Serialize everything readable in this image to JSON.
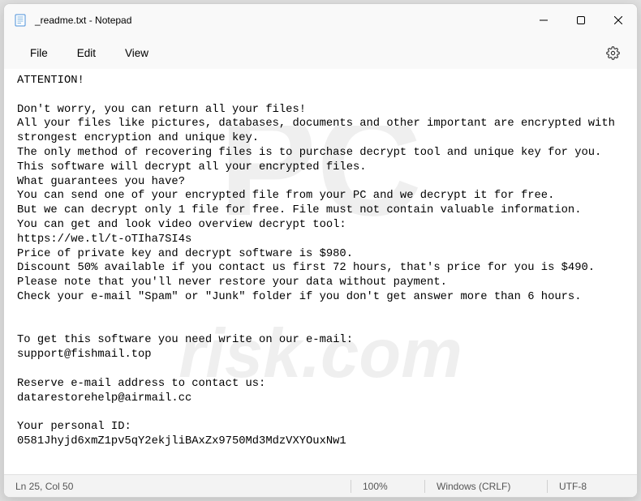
{
  "titlebar": {
    "title": "_readme.txt - Notepad"
  },
  "menu": {
    "file": "File",
    "edit": "Edit",
    "view": "View"
  },
  "content": {
    "text": "ATTENTION!\n\nDon't worry, you can return all your files!\nAll your files like pictures, databases, documents and other important are encrypted with\nstrongest encryption and unique key.\nThe only method of recovering files is to purchase decrypt tool and unique key for you.\nThis software will decrypt all your encrypted files.\nWhat guarantees you have?\nYou can send one of your encrypted file from your PC and we decrypt it for free.\nBut we can decrypt only 1 file for free. File must not contain valuable information.\nYou can get and look video overview decrypt tool:\nhttps://we.tl/t-oTIha7SI4s\nPrice of private key and decrypt software is $980.\nDiscount 50% available if you contact us first 72 hours, that's price for you is $490.\nPlease note that you'll never restore your data without payment.\nCheck your e-mail \"Spam\" or \"Junk\" folder if you don't get answer more than 6 hours.\n\n\nTo get this software you need write on our e-mail:\nsupport@fishmail.top\n\nReserve e-mail address to contact us:\ndatarestorehelp@airmail.cc\n\nYour personal ID:\n0581Jhyjd6xmZ1pv5qY2ekjliBAxZx9750Md3MdzVXYOuxNw1"
  },
  "statusbar": {
    "position": "Ln 25, Col 50",
    "zoom": "100%",
    "line_ending": "Windows (CRLF)",
    "encoding": "UTF-8"
  },
  "watermark": {
    "text": "PCrisk.com"
  }
}
